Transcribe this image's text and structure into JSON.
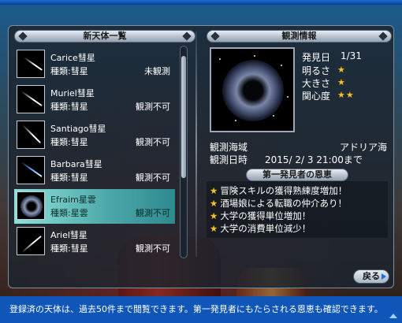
{
  "left_panel": {
    "title": "新天体一覧",
    "items": [
      {
        "name": "Carice彗星",
        "type": "種類:彗星",
        "status": "未観測",
        "icon": "comet-thumbnail"
      },
      {
        "name": "Muriel彗星",
        "type": "種類:彗星",
        "status": "観測不可",
        "icon": "comet-thumbnail"
      },
      {
        "name": "Santiago彗星",
        "type": "種類:彗星",
        "status": "観測不可",
        "icon": "comet-thumbnail"
      },
      {
        "name": "Barbara彗星",
        "type": "種類:彗星",
        "status": "観測不可",
        "icon": "comet-thumbnail"
      },
      {
        "name": "Efraim星雲",
        "type": "種類:星雲",
        "status": "観測不可",
        "icon": "nebula-thumbnail",
        "selected": true
      },
      {
        "name": "Ariel彗星",
        "type": "種類:彗星",
        "status": "観測不可",
        "icon": "comet-thumbnail"
      }
    ]
  },
  "right_panel": {
    "title": "観測情報",
    "discovery_label": "発見日",
    "discovery_value": "1/31",
    "brightness_label": "明るさ",
    "brightness_stars": "★",
    "size_label": "大きさ",
    "size_stars": "★",
    "interest_label": "関心度",
    "interest_stars": "★★",
    "sea_label": "観測海域",
    "sea_value": "アドリア海",
    "datetime_label": "観測日時",
    "datetime_value": "2015/ 2/ 3 21:00まで"
  },
  "bonus_panel": {
    "title": "第一発見者の恩恵",
    "lines": [
      "冒険スキルの獲得熟練度増加！",
      "酒場娘による転職の仲介あり！",
      "大学の獲得単位増加！",
      "大学の消費単位減少！"
    ]
  },
  "back_button": {
    "label": "戻る"
  },
  "status_bar": {
    "text": "登録済の天体は、過去50件まで閲覧できます。第一発見者にもたらされる恩恵も確認できます。"
  },
  "colors": {
    "accent_frame": "#0f56b8",
    "selected_row": "#4aa7a7",
    "star": "#f6c21c"
  }
}
